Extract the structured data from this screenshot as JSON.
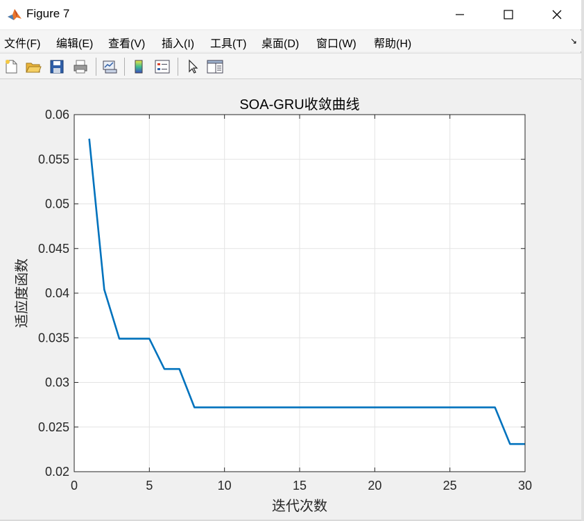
{
  "window": {
    "title": "Figure 7"
  },
  "menu": [
    "文件(F)",
    "编辑(E)",
    "查看(V)",
    "插入(I)",
    "工具(T)",
    "桌面(D)",
    "窗口(W)",
    "帮助(H)"
  ],
  "toolbar": [
    {
      "name": "new-figure-icon"
    },
    {
      "name": "open-file-icon"
    },
    {
      "name": "save-icon"
    },
    {
      "name": "print-icon"
    },
    {
      "name": "link-plot-icon"
    },
    {
      "name": "colorbar-icon"
    },
    {
      "name": "legend-icon"
    },
    {
      "name": "pointer-icon"
    },
    {
      "name": "property-editor-icon"
    }
  ],
  "colors": {
    "line": "#0072BD",
    "grid": "#e3e3e3",
    "axes": "#262626"
  },
  "chart_data": {
    "type": "line",
    "title": "SOA-GRU收敛曲线",
    "xlabel": "迭代次数",
    "ylabel": "适应度函数",
    "xlim": [
      0,
      30
    ],
    "ylim": [
      0.02,
      0.06
    ],
    "xticks": [
      0,
      5,
      10,
      15,
      20,
      25,
      30
    ],
    "yticks": [
      0.02,
      0.025,
      0.03,
      0.035,
      0.04,
      0.045,
      0.05,
      0.055,
      0.06
    ],
    "grid": true,
    "series": [
      {
        "x": [
          1,
          2,
          3,
          4,
          5,
          6,
          7,
          8,
          9,
          10,
          11,
          12,
          13,
          14,
          15,
          16,
          17,
          18,
          19,
          20,
          21,
          22,
          23,
          24,
          25,
          26,
          27,
          28,
          29,
          30
        ],
        "values": [
          0.0573,
          0.0404,
          0.0349,
          0.0349,
          0.0349,
          0.0315,
          0.0315,
          0.0272,
          0.0272,
          0.0272,
          0.0272,
          0.0272,
          0.0272,
          0.0272,
          0.0272,
          0.0272,
          0.0272,
          0.0272,
          0.0272,
          0.0272,
          0.0272,
          0.0272,
          0.0272,
          0.0272,
          0.0272,
          0.0272,
          0.0272,
          0.0272,
          0.0231,
          0.0231
        ]
      }
    ]
  }
}
